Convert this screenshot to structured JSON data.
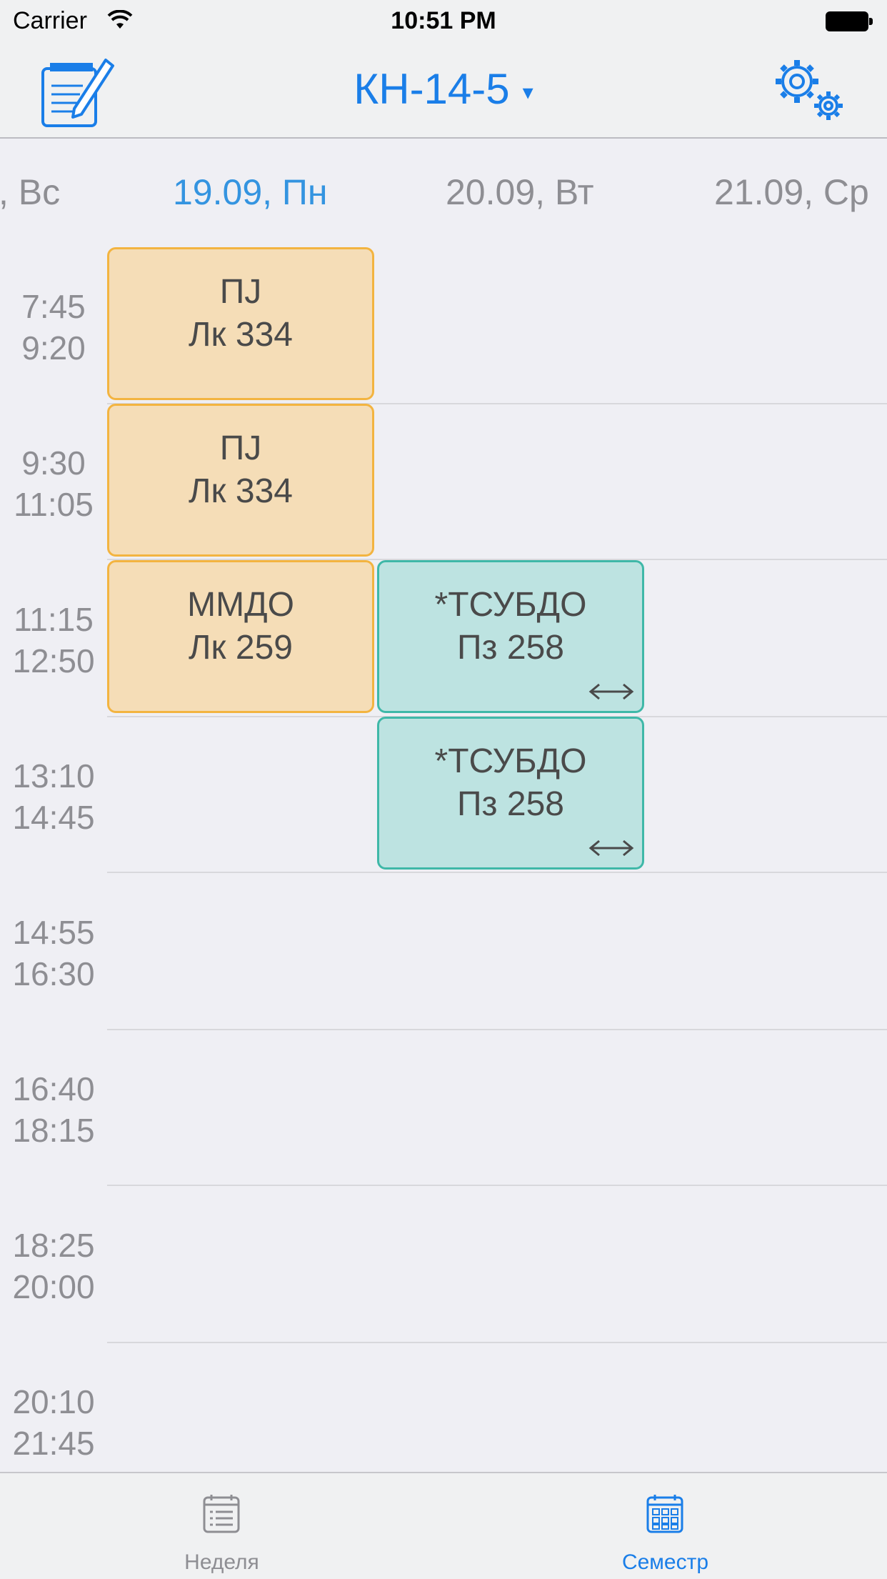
{
  "status_bar": {
    "carrier": "Carrier",
    "time": "10:51 PM"
  },
  "nav": {
    "title": "КН-14-5",
    "caret": "▾",
    "left_icon": "edit-notepad-icon",
    "right_icon": "gears-settings-icon"
  },
  "days": [
    {
      "label": ", Вс",
      "today": false
    },
    {
      "label": "19.09, Пн",
      "today": true
    },
    {
      "label": "20.09, Вт",
      "today": false
    },
    {
      "label": "21.09, Ср",
      "today": false
    }
  ],
  "slots": [
    {
      "start": "7:45",
      "end": "9:20"
    },
    {
      "start": "9:30",
      "end": "11:05"
    },
    {
      "start": "11:15",
      "end": "12:50"
    },
    {
      "start": "13:10",
      "end": "14:45"
    },
    {
      "start": "14:55",
      "end": "16:30"
    },
    {
      "start": "16:40",
      "end": "18:15"
    },
    {
      "start": "18:25",
      "end": "20:00"
    },
    {
      "start": "20:10",
      "end": "21:45"
    }
  ],
  "lessons": [
    {
      "day": 1,
      "slot": 0,
      "subject": "ПJ",
      "room": "Лк 334",
      "kind": "lec",
      "swap": false
    },
    {
      "day": 1,
      "slot": 1,
      "subject": "ПJ",
      "room": "Лк 334",
      "kind": "lec",
      "swap": false
    },
    {
      "day": 1,
      "slot": 2,
      "subject": "ММДО",
      "room": "Лк 259",
      "kind": "lec",
      "swap": false
    },
    {
      "day": 2,
      "slot": 2,
      "subject": "*ТСУБДО",
      "room": "Пз 258",
      "kind": "prac",
      "swap": true
    },
    {
      "day": 2,
      "slot": 3,
      "subject": "*ТСУБДО",
      "room": "Пз 258",
      "kind": "prac",
      "swap": true
    }
  ],
  "tabs": [
    {
      "label": "Неделя",
      "icon": "calendar-list-icon",
      "active": false
    },
    {
      "label": "Семестр",
      "icon": "calendar-grid-icon",
      "active": true
    }
  ],
  "colors": {
    "accent": "#1a7ee8",
    "today": "#3494e0",
    "lecture_bg": "#f5ddb7",
    "lecture_border": "#f3b440",
    "practice_bg": "#bde3e1",
    "practice_border": "#3fb8a8"
  }
}
